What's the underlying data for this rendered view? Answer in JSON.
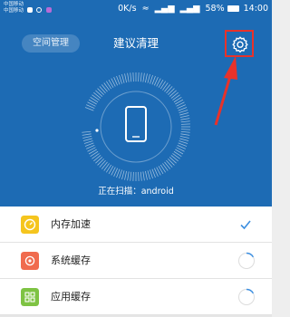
{
  "status_bar": {
    "carrier_line1": "中国移动",
    "carrier_line2": "中国移动",
    "speed": "0K/s",
    "battery": "58%",
    "time": "14:00"
  },
  "header": {
    "space_button_label": "空间管理",
    "title": "建议清理"
  },
  "scan": {
    "status_text": "正在扫描：android"
  },
  "items": [
    {
      "label": "内存加速",
      "icon": "speed-icon",
      "color": "#f5c51e",
      "state": "done"
    },
    {
      "label": "系统缓存",
      "icon": "system-cache-icon",
      "color": "#f06b4e",
      "state": "scanning"
    },
    {
      "label": "应用缓存",
      "icon": "app-cache-icon",
      "color": "#7ec343",
      "state": "scanning"
    }
  ],
  "colors": {
    "header_bg": "#1d6bb4",
    "accent_check": "#3d8fe0",
    "highlight": "#e8322a"
  }
}
